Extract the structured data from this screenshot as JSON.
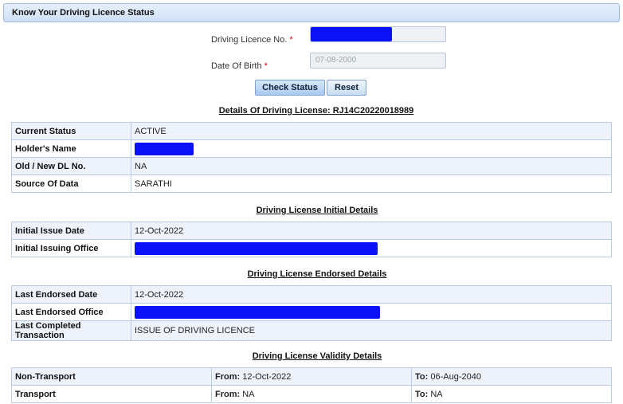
{
  "header": {
    "title": "Know Your Driving Licence Status"
  },
  "form": {
    "dl_label": "Driving Licence No.",
    "dob_label": "Date Of Birth",
    "required_mark": "*",
    "dob_value": "07-08-2000",
    "check_button": "Check Status",
    "reset_button": "Reset"
  },
  "details": {
    "title": "Details Of Driving License: RJ14C20220018989",
    "rows": [
      {
        "label": "Current Status",
        "value": "ACTIVE"
      },
      {
        "label": "Holder's Name",
        "value": ""
      },
      {
        "label": "Old / New DL No.",
        "value": "NA"
      },
      {
        "label": "Source Of Data",
        "value": "SARATHI"
      }
    ]
  },
  "initial": {
    "title": "Driving License Initial Details",
    "rows": [
      {
        "label": "Initial Issue Date",
        "value": "12-Oct-2022"
      },
      {
        "label": "Initial Issuing Office",
        "value": ""
      }
    ]
  },
  "endorsed": {
    "title": "Driving License Endorsed Details",
    "rows": [
      {
        "label": "Last Endorsed Date",
        "value": "12-Oct-2022"
      },
      {
        "label": "Last Endorsed Office",
        "value": ""
      },
      {
        "label": "Last Completed Transaction",
        "value": "ISSUE OF DRIVING LICENCE"
      }
    ]
  },
  "validity": {
    "title": "Driving License Validity Details",
    "from_label": "From:",
    "to_label": "To:",
    "rows": [
      {
        "label": "Non-Transport",
        "from": "12-Oct-2022",
        "to": "06-Aug-2040"
      },
      {
        "label": "Transport",
        "from": "NA",
        "to": "NA"
      }
    ]
  },
  "colors": {
    "redaction": "#0a12f5",
    "header_bg": "#cfe0f5",
    "row_alt": "#eef3fb"
  }
}
